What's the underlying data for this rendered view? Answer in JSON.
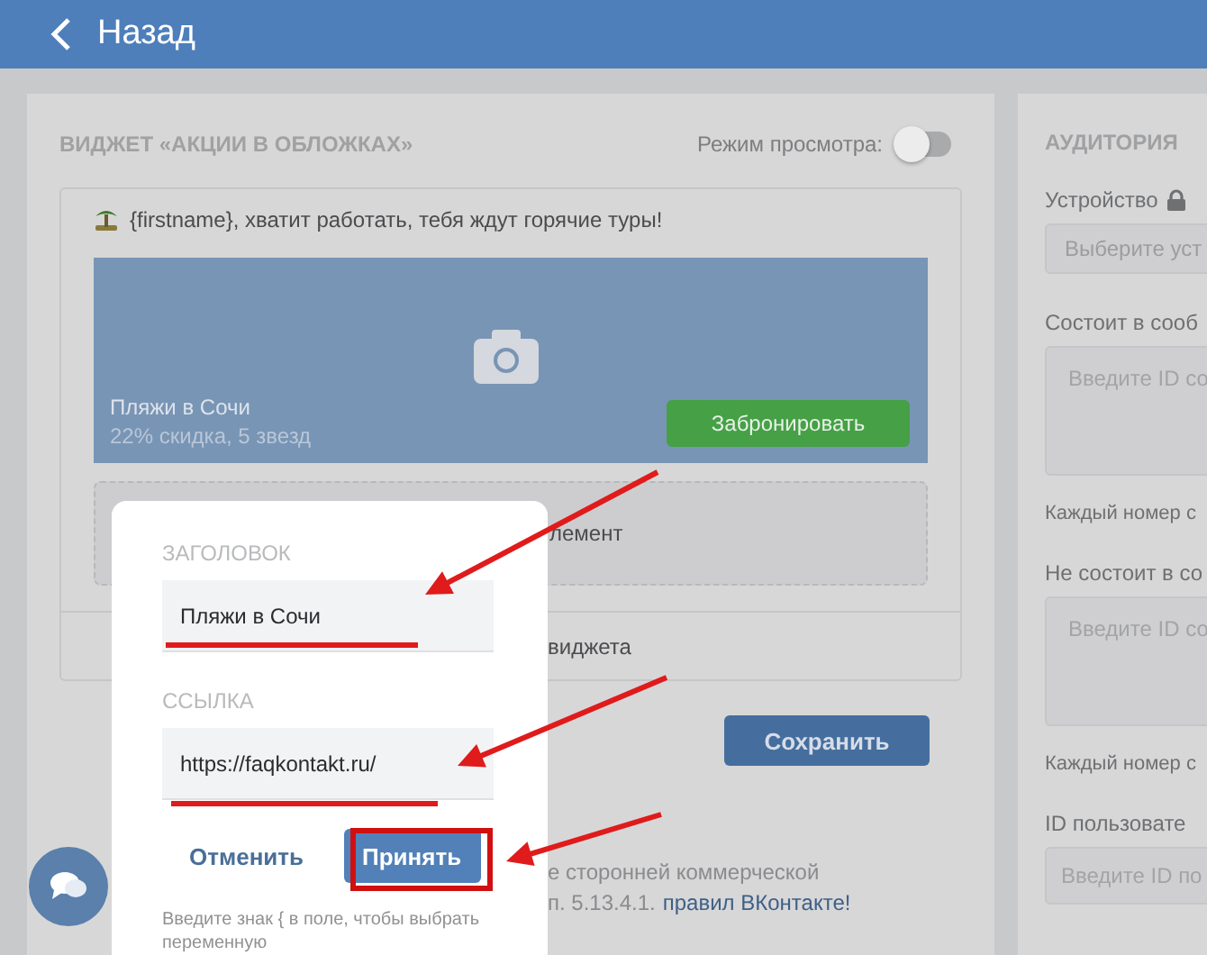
{
  "header": {
    "back_label": "Назад"
  },
  "widget": {
    "title": "ВИДЖЕТ «АКЦИИ В ОБЛОЖКАХ»",
    "preview_mode": {
      "label": "Режим просмотра:",
      "on": false
    },
    "message": "{firstname}, хватит работать, тебя ждут горячие туры!",
    "cover": {
      "title": "Пляжи в Сочи",
      "subtitle": "22% скидка, 5 звезд",
      "button": "Забронировать"
    },
    "add_element_fragment": "лемент",
    "footer_fragment": "виджета",
    "save_button": "Сохранить",
    "notice": {
      "line_1": "е сторонней коммерческой",
      "line_2": "п. 5.13.4.1.",
      "link": "правил ВКонтакте!"
    }
  },
  "audience": {
    "title": "АУДИТОРИЯ",
    "fields": [
      {
        "kind": "select",
        "label": "Устройство",
        "locked": true,
        "placeholder": "Выберите уст"
      },
      {
        "kind": "textarea",
        "label": "Состоит в сооб",
        "placeholder": "Введите ID со",
        "hint": "Каждый номер с"
      },
      {
        "kind": "textarea",
        "label": "Не состоит в со",
        "placeholder": "Введите ID со",
        "hint": "Каждый номер с"
      },
      {
        "kind": "input",
        "label": "ID пользовате",
        "placeholder": "Введите ID по"
      }
    ]
  },
  "popup": {
    "fields": [
      {
        "label": "ЗАГОЛОВОК",
        "value": "Пляжи в Сочи"
      },
      {
        "label": "ССЫЛКА",
        "value": "https://faqkontakt.ru/"
      }
    ],
    "cancel": "Отменить",
    "accept": "Принять",
    "hint": "Введите знак { в поле, чтобы выбрать переменную"
  }
}
